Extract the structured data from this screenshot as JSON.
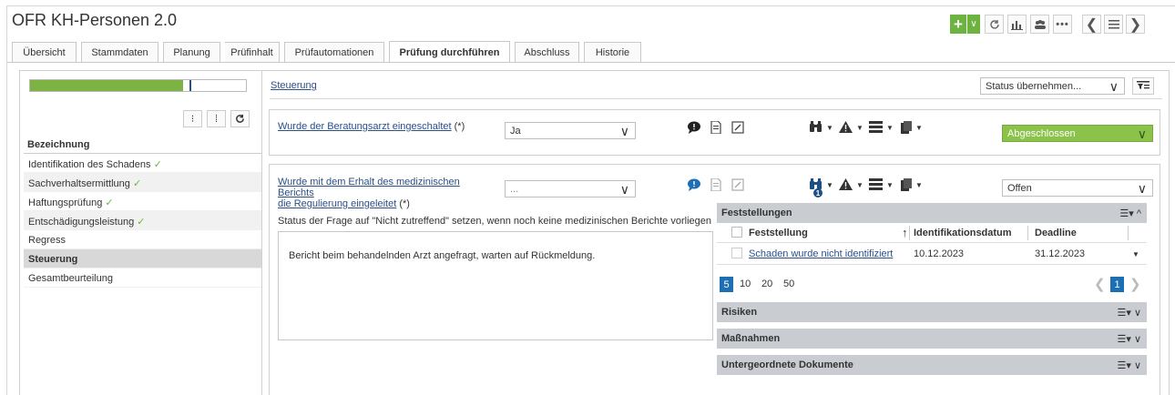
{
  "app": {
    "title": "OFR KH-Personen 2.0"
  },
  "tabs": [
    "Übersicht",
    "Stammdaten",
    "Planung",
    "Prüfinhalt",
    "Prüfautomationen",
    "Prüfung durchführen",
    "Abschluss",
    "Historie"
  ],
  "progress": {
    "value": 0.71,
    "marker": 0.74
  },
  "nav": {
    "header": "Bezeichnung",
    "items": [
      {
        "label": "Identifikation des Schadens",
        "done": "✓"
      },
      {
        "label": "Sachverhaltsermittlung",
        "done": "✓"
      },
      {
        "label": "Haftungsprüfung",
        "done": "✓"
      },
      {
        "label": "Entschädigungsleistung",
        "done": "✓"
      },
      {
        "label": "Regress",
        "done": ""
      },
      {
        "label": "Steuerung",
        "done": ""
      },
      {
        "label": "Gesamtbeurteilung",
        "done": ""
      }
    ]
  },
  "main": {
    "breadcrumb": "Steuerung",
    "status_select": "Status übernehmen...",
    "q1": {
      "link": "Wurde der Beratungsarzt eingeschaltet",
      "suffix": " (*)",
      "answer": "Ja",
      "status": "Abgeschlossen"
    },
    "q2": {
      "link_line1": "Wurde mit dem Erhalt des medizinischen Berichts",
      "link_line2": "die Regulierung eingeleitet",
      "suffix": " (*)",
      "answer": "...",
      "status": "Offen",
      "hint": "Status der Frage auf \"Nicht zutreffend\" setzen, wenn noch keine medizinischen Berichte vorliegen",
      "note": "Bericht beim behandelnden Arzt angefragt, warten auf Rückmeldung.",
      "badge": "1"
    },
    "feststellungen": {
      "title": "Feststellungen",
      "columns": [
        "Feststellung",
        "Identifikationsdatum",
        "Deadline"
      ],
      "rows": [
        {
          "text": "Schaden wurde nicht identifiziert",
          "date": "10.12.2023",
          "deadline": "31.12.2023"
        }
      ],
      "page_sizes": [
        "5",
        "10",
        "20",
        "50"
      ],
      "page": "1"
    },
    "sections": [
      "Risiken",
      "Maßnahmen",
      "Untergeordnete Dokumente"
    ]
  },
  "colors": {
    "accent_green": "#6db33f",
    "link": "#2a4f8a",
    "pager_active": "#1d6fb5"
  }
}
